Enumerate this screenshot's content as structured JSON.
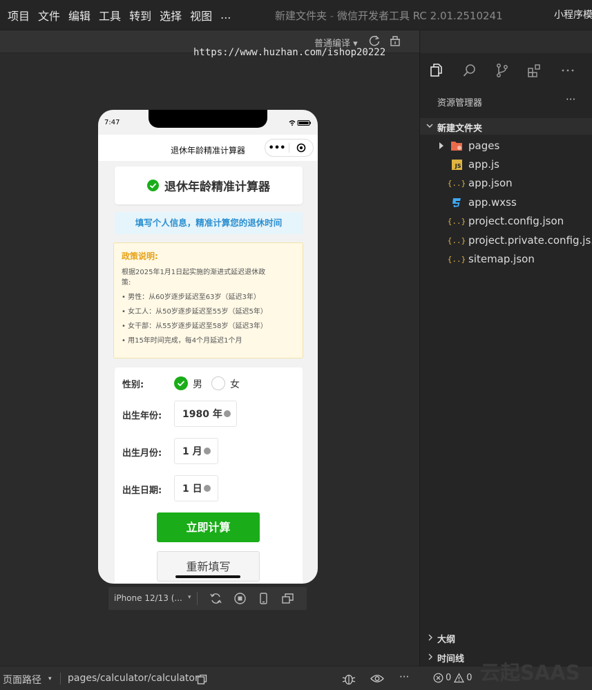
{
  "menu": {
    "items": [
      "项目",
      "文件",
      "编辑",
      "工具",
      "转到",
      "选择",
      "视图",
      "..."
    ],
    "window_title": "新建文件夹",
    "title_sep": " - ",
    "app_title": "微信开发者工具 RC 2.01.2510241",
    "right_title": "小程序模"
  },
  "sim_toolbar": {
    "compile_label": "普通编译 ▾"
  },
  "watermark": "https://www.huzhan.com/ishop20222",
  "phone": {
    "status_time": "7:47",
    "nav_title": "退休年龄精准计算器",
    "capsule_dots": "•••",
    "card_title": "退休年龄精准计算器",
    "subtitle": "填写个人信息，精准计算您的退休时间",
    "policy": {
      "title": "政策说明:",
      "intro_1": "根据2025年1月1日起实施的渐进式延迟退休政",
      "intro_2": "策:",
      "line_1": "• 男性：从60岁逐步延迟至63岁（延迟3年）",
      "line_2": "• 女工人：从50岁逐步延迟至55岁（延迟5年）",
      "line_3": "• 女干部：从55岁逐步延迟至58岁（延迟3年）",
      "line_4": "• 用15年时间完成，每4个月延迟1个月"
    },
    "form": {
      "gender_label": "性别:",
      "male": "男",
      "female": "女",
      "year_label": "出生年份:",
      "year_value": "1980 年",
      "month_label": "出生月份:",
      "month_value": "1 月",
      "day_label": "出生日期:",
      "day_value": "1 日"
    },
    "calc_button": "立即计算",
    "reset_button": "重新填写"
  },
  "device_bar": {
    "device_name": "iPhone 12/13 (...",
    "caret": "▾"
  },
  "explorer": {
    "title": "资源管理器",
    "more": "···",
    "folder": "新建文件夹",
    "files": [
      "pages",
      "app.js",
      "app.json",
      "app.wxss",
      "project.config.json",
      "project.private.config.js...",
      "sitemap.json"
    ],
    "json_icon": "{..}",
    "js_icon": "JS",
    "outline": "大纲",
    "timeline": "时间线"
  },
  "statusbar": {
    "page_path_label": "页面路径",
    "caret": "▾",
    "path": "pages/calculator/calculator",
    "more": "···",
    "errors": "0",
    "warnings": "0",
    "brand": "云起SAAS"
  },
  "colors": {
    "accent_green": "#1aad19",
    "info_blue": "#2b8fd0",
    "policy_orange": "#e6a217"
  }
}
